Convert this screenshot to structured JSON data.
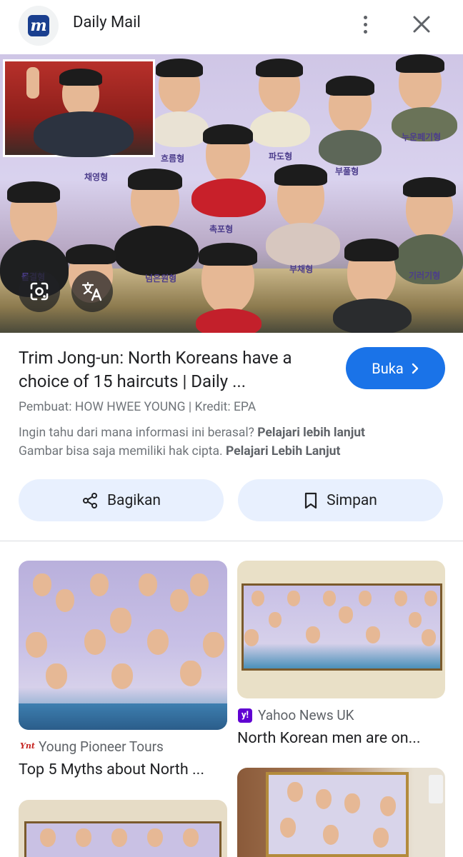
{
  "header": {
    "source_name": "Daily Mail",
    "logo_letter": "m"
  },
  "hero": {
    "labels": [
      "채영형",
      "흐름형",
      "파도형",
      "부풀형",
      "누운페기형",
      "촉포형",
      "부채형",
      "넘은원형",
      "기러기형",
      "물결형"
    ]
  },
  "result": {
    "title": "Trim Jong-un: North Koreans have a choice of 15 haircuts | Daily ...",
    "open_label": "Buka",
    "credit": "Pembuat: HOW HWEE YOUNG | Kredit: EPA",
    "info_line1": "Ingin tahu dari mana informasi ini berasal?",
    "info_link1": "Pelajari lebih lanjut",
    "info_line2": "Gambar bisa saja memiliki hak cipta.",
    "info_link2": "Pelajari Lebih Lanjut"
  },
  "actions": {
    "share_label": "Bagikan",
    "save_label": "Simpan"
  },
  "related": [
    {
      "source": "Young Pioneer Tours",
      "favicon_text": "Ynt",
      "title": "Top 5 Myths about North ..."
    },
    {
      "source": "Yahoo News UK",
      "favicon_text": "y!",
      "title": "North Korean men are on..."
    }
  ],
  "colors": {
    "accent": "#1a73e8",
    "action_bg": "#e8f0fe",
    "muted_text": "#70757a"
  }
}
